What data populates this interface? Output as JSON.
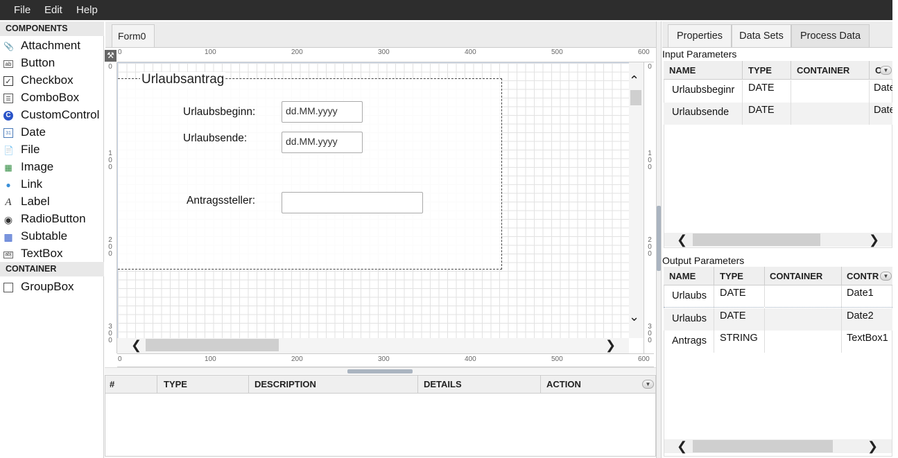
{
  "menubar": {
    "items": [
      "File",
      "Edit",
      "Help"
    ]
  },
  "palette": {
    "components_header": "COMPONENTS",
    "components": [
      {
        "label": "Attachment",
        "icon": "paperclip-icon"
      },
      {
        "label": "Button",
        "icon": "button-icon"
      },
      {
        "label": "Checkbox",
        "icon": "checkbox-icon"
      },
      {
        "label": "ComboBox",
        "icon": "combobox-icon"
      },
      {
        "label": "CustomControl",
        "icon": "custom-control-icon"
      },
      {
        "label": "Date",
        "icon": "calendar-icon"
      },
      {
        "label": "File",
        "icon": "file-icon"
      },
      {
        "label": "Image",
        "icon": "image-icon"
      },
      {
        "label": "Link",
        "icon": "globe-icon"
      },
      {
        "label": "Label",
        "icon": "label-icon"
      },
      {
        "label": "RadioButton",
        "icon": "radio-icon"
      },
      {
        "label": "Subtable",
        "icon": "table-icon"
      },
      {
        "label": "TextBox",
        "icon": "textbox-icon"
      }
    ],
    "container_header": "CONTAINER",
    "containers": [
      {
        "label": "GroupBox",
        "icon": "groupbox-icon"
      }
    ]
  },
  "editor": {
    "tab": "Form0",
    "ruler_labels": [
      "0",
      "100",
      "200",
      "300",
      "400",
      "500",
      "600"
    ],
    "vruler_labels": [
      "0",
      "100",
      "200",
      "300"
    ],
    "form": {
      "title": "Urlaubsantrag",
      "start_label": "Urlaubsbeginn:",
      "start_placeholder": "dd.MM.yyyy",
      "end_label": "Urlaubsende:",
      "end_placeholder": "dd.MM.yyyy",
      "applicant_label": "Antragssteller:",
      "applicant_value": ""
    }
  },
  "issues": {
    "columns": [
      "#",
      "TYPE",
      "DESCRIPTION",
      "DETAILS",
      "ACTION"
    ]
  },
  "right_panel": {
    "tabs": [
      "Properties",
      "Data Sets",
      "Process Data"
    ],
    "active_tab": "Process Data",
    "input": {
      "label": "Input Parameters",
      "columns": [
        "NAME",
        "TYPE",
        "CONTAINER",
        "C"
      ],
      "rows": [
        [
          "Urlaubsbeginr",
          "DATE",
          "",
          "Date"
        ],
        [
          "Urlaubsende",
          "DATE",
          "",
          "Date"
        ]
      ]
    },
    "output": {
      "label": "Output Parameters",
      "columns": [
        "NAME",
        "TYPE",
        "CONTAINER",
        "CONTR"
      ],
      "rows": [
        [
          "Urlaubs",
          "DATE",
          "",
          "Date1"
        ],
        [
          "Urlaubs",
          "DATE",
          "",
          "Date2"
        ],
        [
          "Antrags",
          "STRING",
          "",
          "TextBox1"
        ]
      ]
    }
  }
}
